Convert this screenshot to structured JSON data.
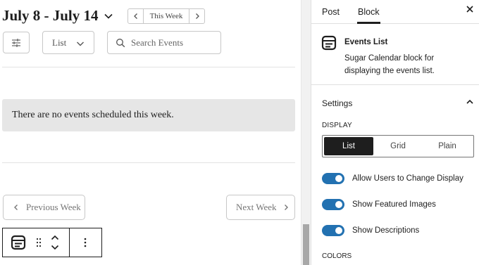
{
  "calendar": {
    "date_range": "July 8 - July 14",
    "week_nav_label": "This Week",
    "display_value": "List",
    "search_placeholder": "Search Events",
    "empty_message": "There are no events scheduled this week.",
    "prev_label": "Previous Week",
    "next_label": "Next Week"
  },
  "sidebar": {
    "tabs": [
      {
        "label": "Post",
        "active": false
      },
      {
        "label": "Block",
        "active": true
      }
    ],
    "block_name": "Events List",
    "block_description": "Sugar Calendar block for displaying the events list.",
    "settings_title": "Settings",
    "display_label": "DISPLAY",
    "display_options": [
      "List",
      "Grid",
      "Plain"
    ],
    "display_selected": "List",
    "toggles": [
      {
        "label": "Allow Users to Change Display",
        "on": true
      },
      {
        "label": "Show Featured Images",
        "on": true
      },
      {
        "label": "Show Descriptions",
        "on": true
      }
    ],
    "colors_label": "COLORS"
  },
  "colors": {
    "accent": "#2271b1",
    "dark": "#1e1e1e",
    "notice_bg": "#e6e6e6",
    "border": "#c7c7c7"
  },
  "icons": {
    "date_dropdown": "chevron-down-icon",
    "prev_week": "chevron-left-icon",
    "next_week": "chevron-right-icon",
    "filter": "sliders-icon",
    "search": "search-icon",
    "block": "calendar-block-icon",
    "drag": "drag-handle-icon",
    "move": "move-up-down-icon",
    "options": "more-vertical-icon",
    "close": "close-icon",
    "collapse": "chevron-up-icon"
  }
}
